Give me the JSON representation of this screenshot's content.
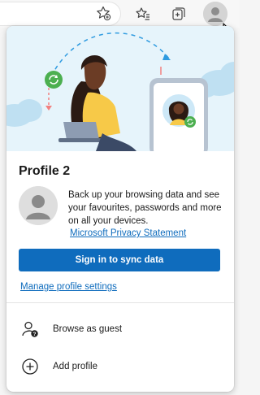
{
  "flyout": {
    "profile_name": "Profile 2",
    "backup_text": "Back up your browsing data and see your favourites, passwords and more on all your devices.",
    "privacy_link": "Microsoft Privacy Statement",
    "sync_button": "Sign in to sync data",
    "manage_link": "Manage profile settings",
    "menu": [
      {
        "label": "Browse as guest",
        "icon": "guest-icon"
      },
      {
        "label": "Add profile",
        "icon": "add-profile-icon"
      }
    ]
  },
  "toolbar": {
    "icons": [
      "add-favourite-icon",
      "favourites-icon",
      "collections-icon",
      "profile-avatar-icon"
    ]
  },
  "colors": {
    "accent": "#0f6cbd",
    "link": "#0f6cbd",
    "sync_badge": "#4caf50"
  }
}
